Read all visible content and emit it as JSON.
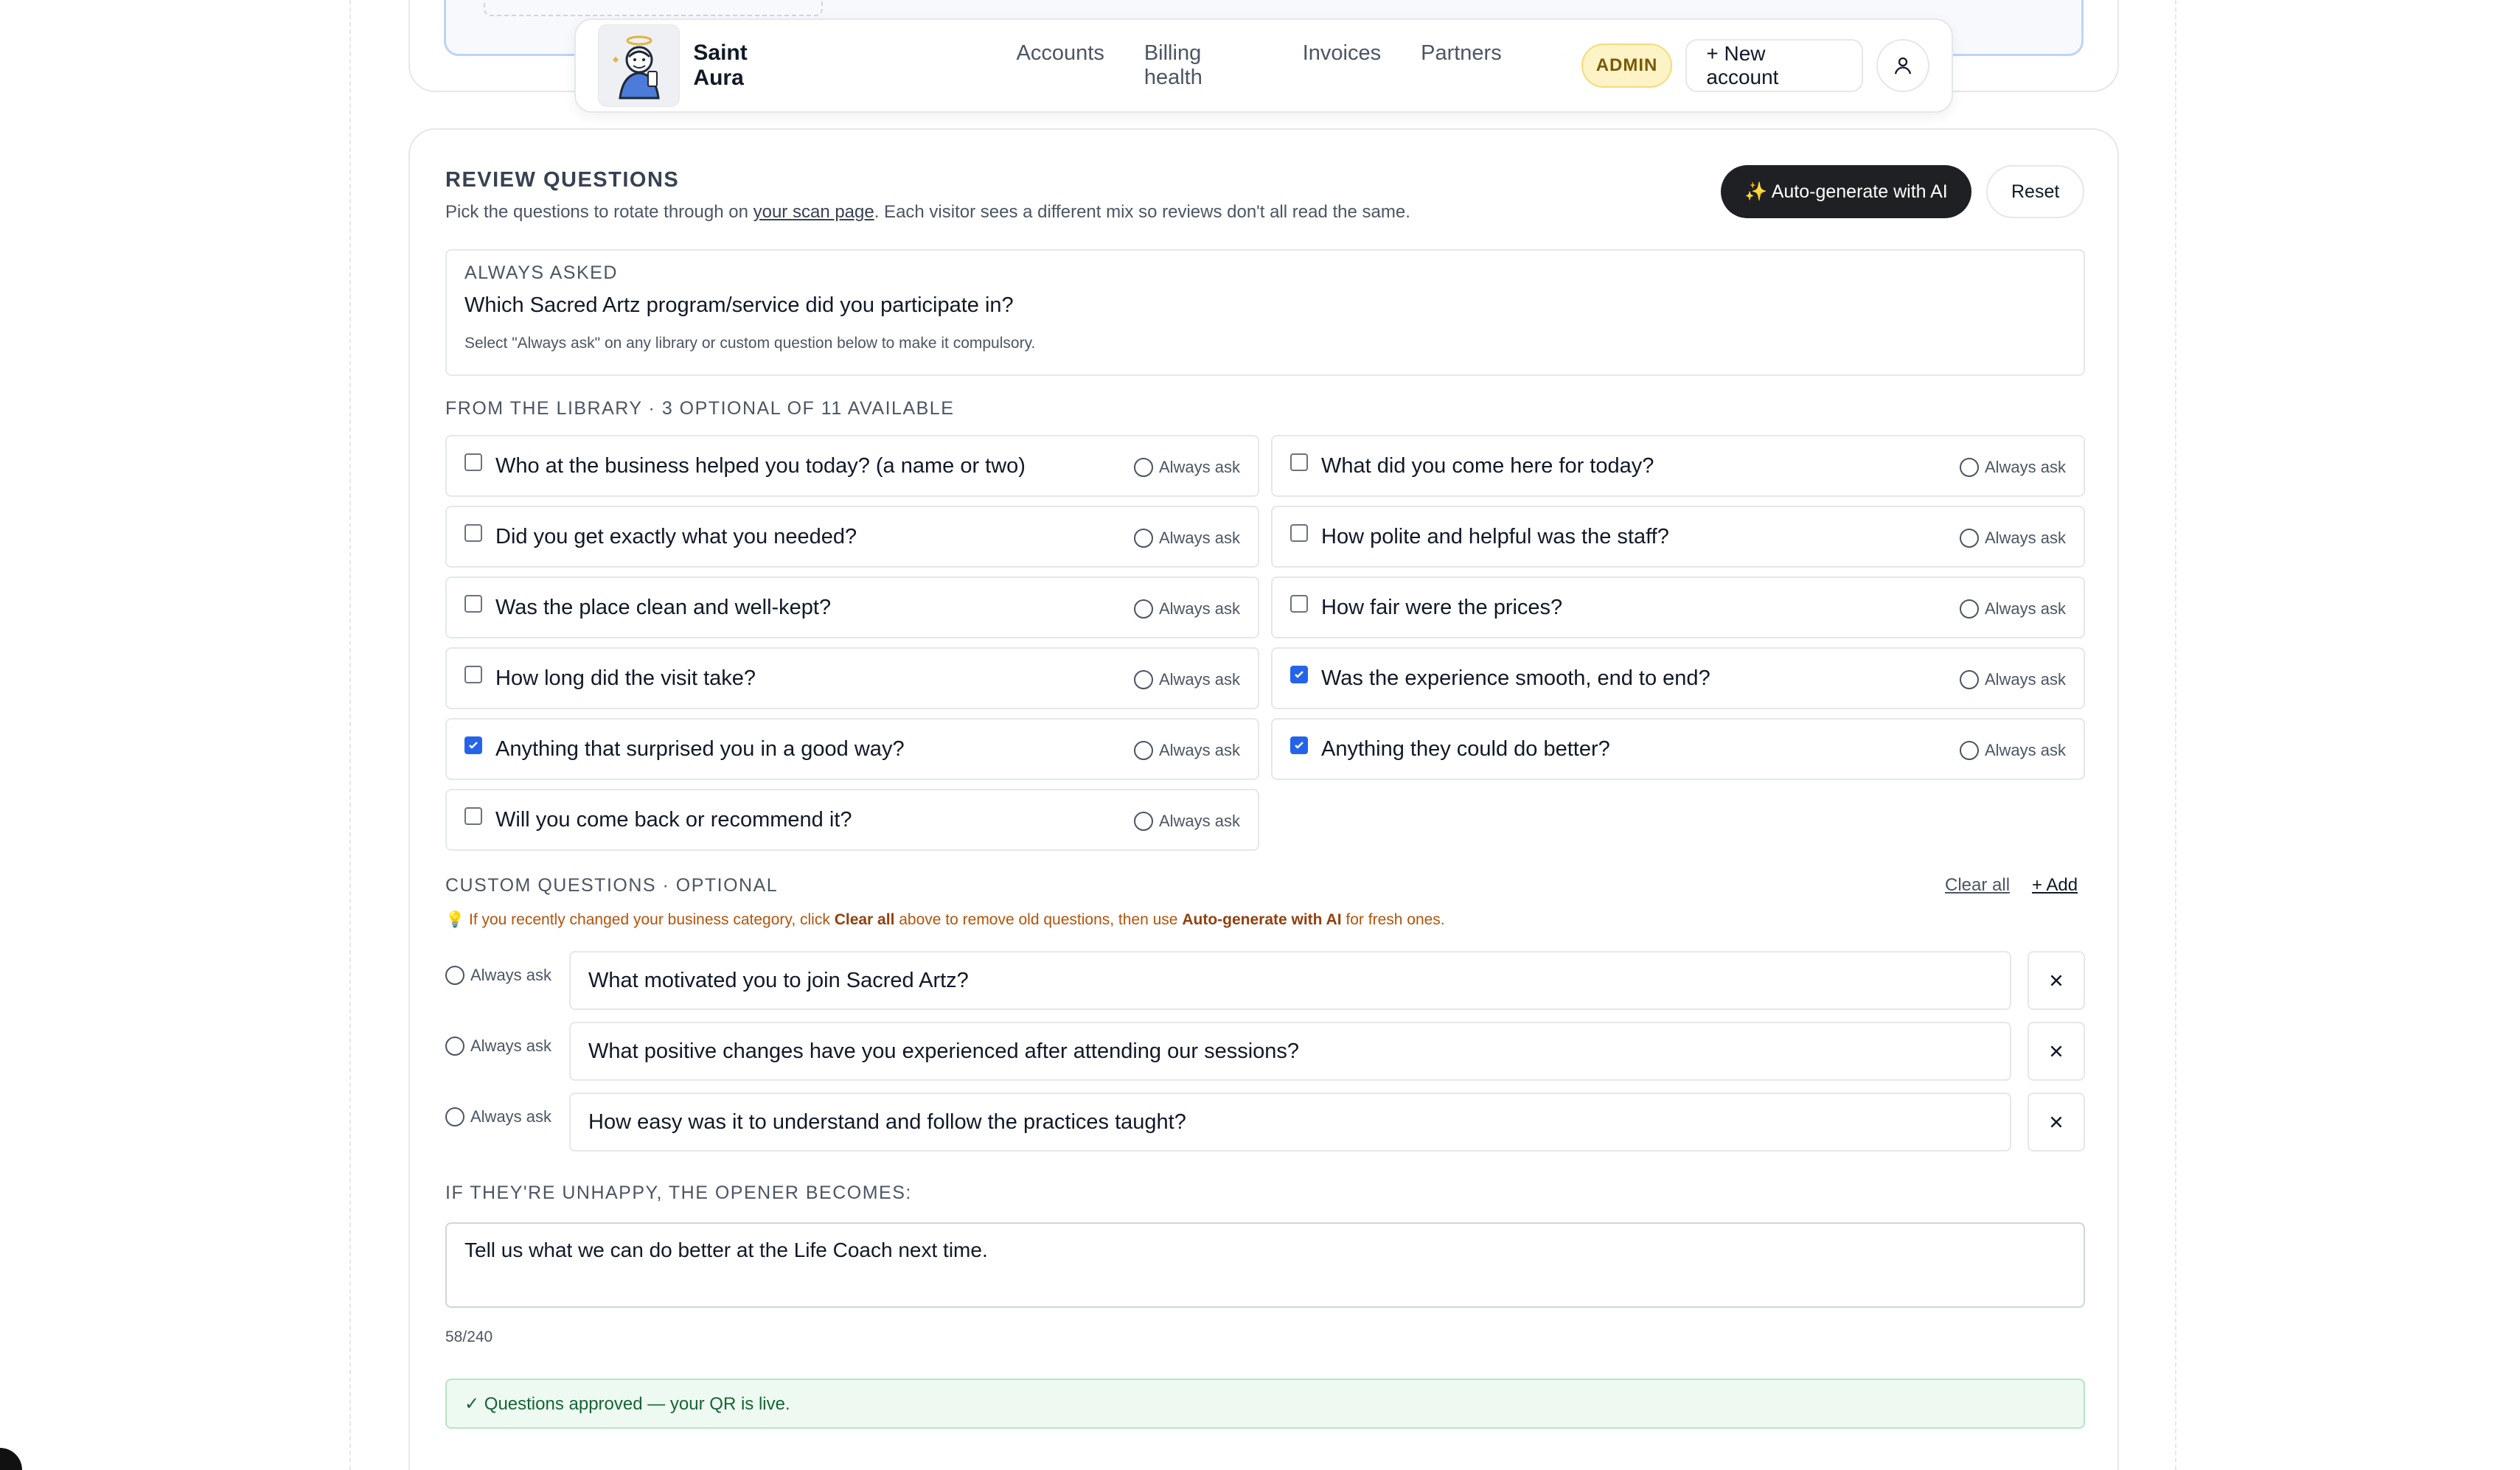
{
  "header": {
    "brand": "Saint Aura",
    "nav": [
      "Accounts",
      "Billing health",
      "Invoices",
      "Partners"
    ],
    "admin_badge": "ADMIN",
    "new_account": "+ New account"
  },
  "review": {
    "title": "REVIEW QUESTIONS",
    "subtitle_pre": "Pick the questions to rotate through on ",
    "subtitle_link": "your scan page",
    "subtitle_post": ". Each visitor sees a different mix so reviews don't all read the same.",
    "auto_generate": "✨ Auto-generate with AI",
    "reset": "Reset"
  },
  "always_asked": {
    "label": "ALWAYS ASKED",
    "question": "Which Sacred Artz program/service did you participate in?",
    "note": "Select \"Always ask\" on any library or custom question below to make it compulsory."
  },
  "library": {
    "heading": "FROM THE LIBRARY · 3 OPTIONAL OF 11 AVAILABLE",
    "always_ask_label": "Always ask",
    "left": [
      {
        "text": "Who at the business helped you today? (a name or two)",
        "checked": false
      },
      {
        "text": "Did you get exactly what you needed?",
        "checked": false
      },
      {
        "text": "Was the place clean and well-kept?",
        "checked": false
      },
      {
        "text": "How long did the visit take?",
        "checked": false
      },
      {
        "text": "Anything that surprised you in a good way?",
        "checked": true
      },
      {
        "text": "Will you come back or recommend it?",
        "checked": false
      }
    ],
    "right": [
      {
        "text": "What did you come here for today?",
        "checked": false
      },
      {
        "text": "How polite and helpful was the staff?",
        "checked": false
      },
      {
        "text": "How fair were the prices?",
        "checked": false
      },
      {
        "text": "Was the experience smooth, end to end?",
        "checked": true
      },
      {
        "text": "Anything they could do better?",
        "checked": true
      }
    ]
  },
  "custom": {
    "heading": "CUSTOM QUESTIONS · OPTIONAL",
    "clear_all": "Clear all",
    "add": "+ Add",
    "tip_icon": "💡",
    "tip_1": " If you recently changed your business category, click ",
    "tip_b1": "Clear all",
    "tip_2": " above to remove old questions, then use ",
    "tip_b2": "Auto-generate with AI",
    "tip_3": " for fresh ones.",
    "always_ask_label": "Always ask",
    "questions": [
      "What motivated you to join Sacred Artz?",
      "What positive changes have you experienced after attending our sessions?",
      "How easy was it to understand and follow the practices taught?"
    ]
  },
  "unhappy": {
    "heading": "IF THEY'RE UNHAPPY, THE OPENER BECOMES:",
    "text": "Tell us what we can do better at the Life Coach next time.",
    "counter": "58/240"
  },
  "status": {
    "text": "✓ Questions approved — your QR is live."
  },
  "colors": {
    "accent": "#2563eb",
    "dark_button": "#1f2023",
    "admin_bg": "#fdf3c7",
    "tip": "#b45309",
    "success_bg": "#eefaf1",
    "success_text": "#166534"
  }
}
